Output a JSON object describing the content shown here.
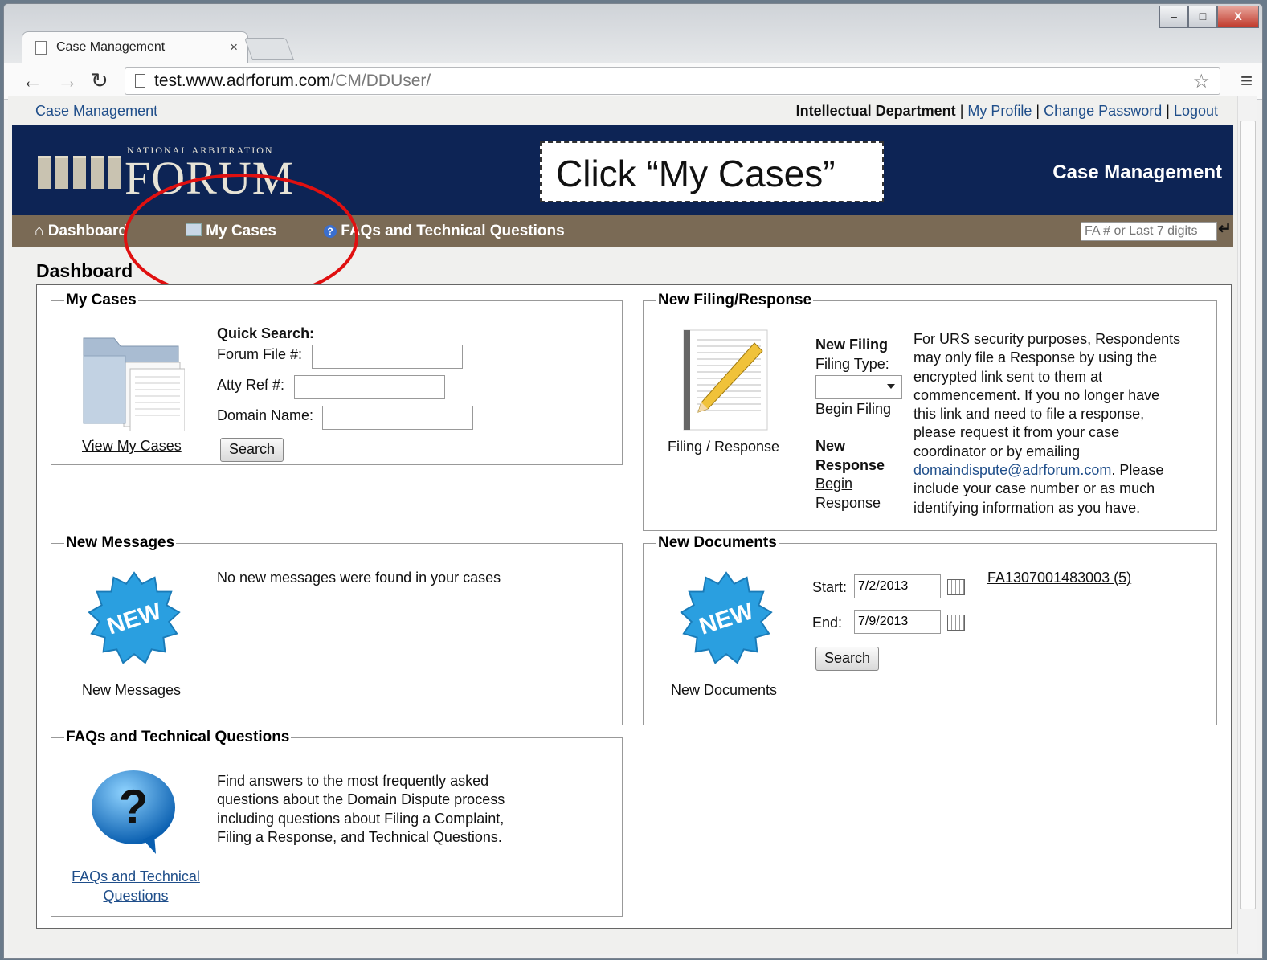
{
  "browser": {
    "tab_title": "Case Management",
    "tab_close": "×",
    "url_host": "test.www.adrforum.com",
    "url_path": "/CM/DDUser/",
    "window_min": "–",
    "window_max": "□",
    "window_close": "X"
  },
  "top_links": {
    "home": "Case Management",
    "department": "Intellectual Department",
    "sep": "|",
    "my_profile": "My Profile",
    "change_password": "Change Password",
    "logout": "Logout"
  },
  "banner": {
    "logo_small": "NATIONAL ARBITRATION",
    "logo_big": "FORUM",
    "callout": "Click “My Cases”",
    "right_title": "Case Management"
  },
  "nav": {
    "dashboard": "Dashboard",
    "my_cases": "My Cases",
    "faqs": "FAQs and Technical Questions",
    "search_placeholder": "FA # or Last 7 digits"
  },
  "page_title": "Dashboard",
  "my_cases": {
    "legend": "My Cases",
    "view_link": "View My Cases",
    "quick_search": "Quick Search:",
    "forum_file_label": "Forum File #:",
    "atty_ref_label": "Atty Ref #:",
    "domain_name_label": "Domain Name:",
    "search_button": "Search"
  },
  "new_filing": {
    "legend": "New Filing/Response",
    "image_caption": "Filing / Response",
    "new_filing_title": "New Filing",
    "filing_type_label": "Filing Type:",
    "begin_filing": "Begin Filing",
    "new_response_title_1": "New",
    "new_response_title_2": "Response",
    "begin_response_1": "Begin",
    "begin_response_2": "Response",
    "notice_lines": [
      "For URS security purposes, Respondents",
      "may only file a Response by using the",
      "encrypted link sent to them at",
      "commencement. If you no longer have",
      "this link and need to file a response,",
      "please request it from your case",
      "coordinator or by emailing"
    ],
    "notice_email": "domaindispute@adrforum.com",
    "notice_after_email": ". Please",
    "notice_lines_2": [
      "include your case number or as much",
      "identifying information as you have."
    ]
  },
  "new_messages": {
    "legend": "New Messages",
    "badge": "NEW",
    "caption": "New Messages",
    "message": "No new messages were found in your cases"
  },
  "new_documents": {
    "legend": "New Documents",
    "badge": "NEW",
    "caption": "New Documents",
    "start_label": "Start:",
    "start_value": "7/2/2013",
    "end_label": "End:",
    "end_value": "7/9/2013",
    "search_button": "Search",
    "result_link": "FA1307001483003 (5)"
  },
  "faqs": {
    "legend": "FAQs and Technical Questions",
    "icon_glyph": "?",
    "description_lines": [
      "Find answers to the most frequently asked",
      "questions about the Domain Dispute process",
      "including questions about Filing a Complaint,",
      "Filing a Response, and Technical Questions."
    ],
    "link_line_1": "FAQs and Technical",
    "link_line_2": "Questions"
  },
  "colors": {
    "banner": "#0d2455",
    "navbar": "#7a6a55",
    "link": "#1f4e8a",
    "highlight_circle": "#e01010",
    "badge": "#2a9fe0"
  }
}
